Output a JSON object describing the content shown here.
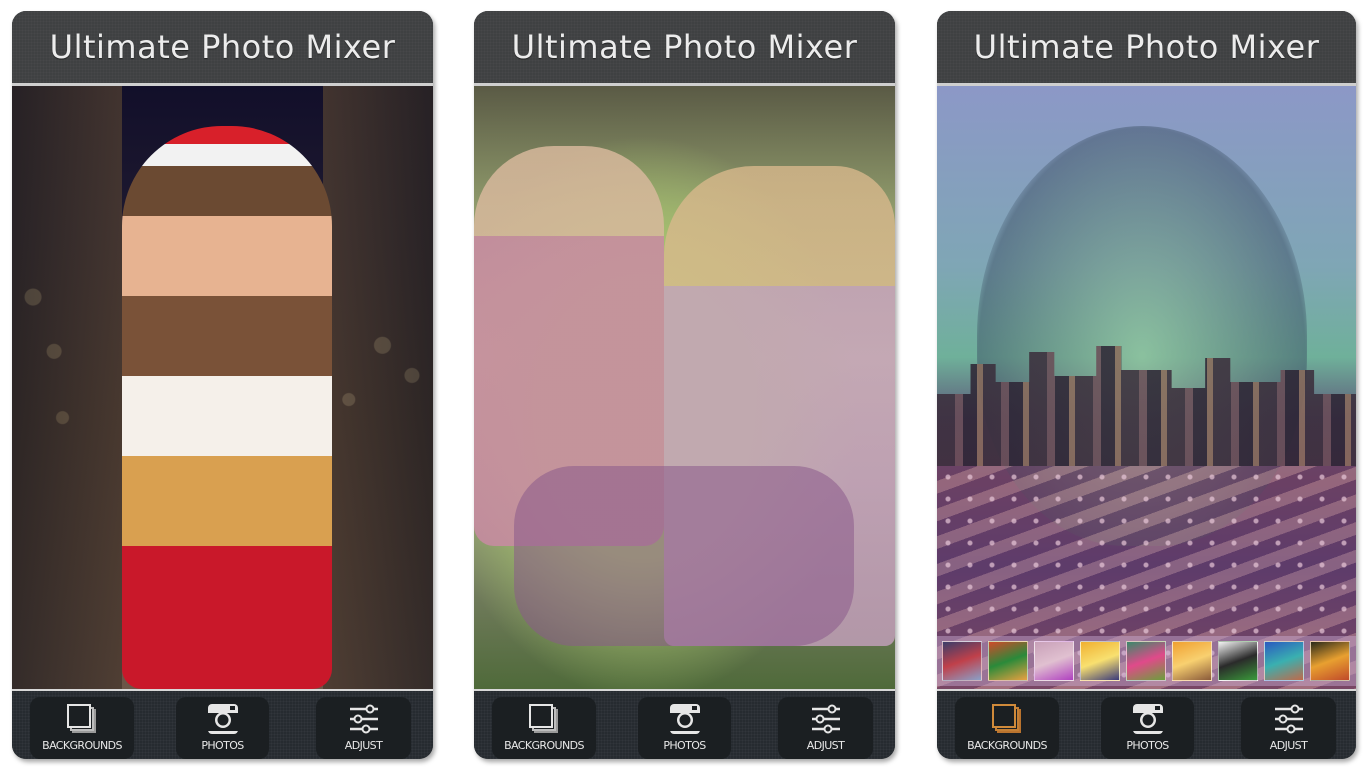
{
  "app_title": "Ultimate Photo Mixer",
  "panels": [
    {
      "title": "Ultimate Photo Mixer",
      "photo_description": "Woman in Santa hat holding gift blended with night street lights",
      "toolbar": {
        "backgrounds_label": "BACKGROUNDS",
        "photos_label": "PHOTOS",
        "adjust_label": "ADJUST",
        "active": "none"
      }
    },
    {
      "title": "Ultimate Photo Mixer",
      "photo_description": "Smiling couple sitting on grass blended with a woman's face",
      "toolbar": {
        "backgrounds_label": "BACKGROUNDS",
        "photos_label": "PHOTOS",
        "adjust_label": "ADJUST",
        "active": "none"
      }
    },
    {
      "title": "Ultimate Photo Mixer",
      "photo_description": "Woman's face blended with city skyline, bridge and American flag",
      "thumbnails": [
        {
          "name": "bridge-lights",
          "colors": [
            "#3a3e6a",
            "#c0404a",
            "#8aa0c8"
          ]
        },
        {
          "name": "colorful-landscape",
          "colors": [
            "#d04a2a",
            "#2a8a3a",
            "#e8a040"
          ]
        },
        {
          "name": "pink-bokeh",
          "colors": [
            "#c8a0b8",
            "#e0c0d0",
            "#b040c0"
          ]
        },
        {
          "name": "sunset-sea",
          "colors": [
            "#f0b030",
            "#f8e070",
            "#3a3a7a"
          ]
        },
        {
          "name": "flowers-green",
          "colors": [
            "#3a8a6a",
            "#e04a8a",
            "#6aa03a"
          ]
        },
        {
          "name": "city-light-trails",
          "colors": [
            "#f0a030",
            "#f8d070",
            "#8a5a3a"
          ]
        },
        {
          "name": "soccer-ball",
          "colors": [
            "#f4f4f4",
            "#2a2a2a",
            "#3a9a3a"
          ]
        },
        {
          "name": "city-skyline-blue",
          "colors": [
            "#2a5ac0",
            "#3ab0b0",
            "#c06a4a"
          ]
        },
        {
          "name": "golden-night-tree",
          "colors": [
            "#2a2a1a",
            "#e8a030",
            "#c04a2a"
          ]
        }
      ],
      "toolbar": {
        "backgrounds_label": "BACKGROUNDS",
        "photos_label": "PHOTOS",
        "adjust_label": "ADJUST",
        "active": "backgrounds"
      }
    }
  ],
  "colors": {
    "header_bg": "#3f4142",
    "toolbar_bg": "#262b30",
    "button_bg": "#1b1f22",
    "icon_default": "#e6e6e6",
    "icon_active": "#d08a3a",
    "title_text": "#ececec"
  }
}
